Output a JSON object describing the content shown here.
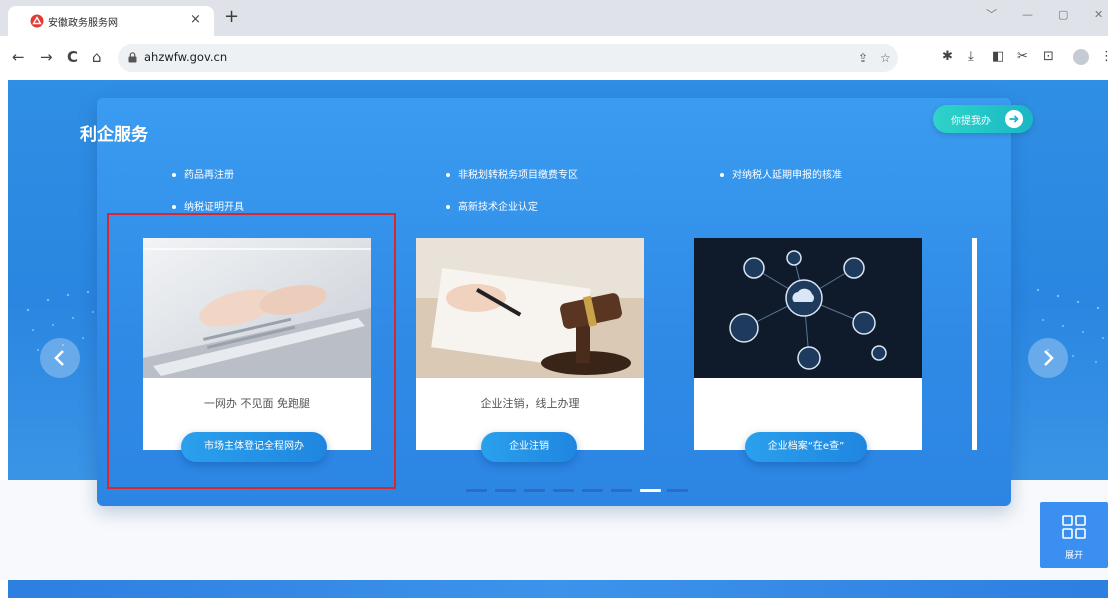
{
  "browser": {
    "tab_title": "安徽政务服务网",
    "tab_close": "×",
    "new_tab": "+",
    "url": "ahzwfw.gov.cn",
    "window_controls": [
      "﹀",
      "—",
      "▢",
      "✕"
    ],
    "nav": {
      "back": "←",
      "forward": "→",
      "reload": "C",
      "home": "⌂"
    },
    "toolbar_icons": [
      "share-icon",
      "star-icon",
      "extensions-icon",
      "download-icon",
      "sidebar-icon",
      "cut-icon",
      "devices-icon",
      "profile-icon",
      "menu-icon"
    ]
  },
  "page": {
    "section_title": "利企服务",
    "find_button": "你提我办",
    "service_links": [
      "药品再注册",
      "非税划转税务项目缴费专区",
      "对纳税人延期申报的核准",
      "纳税证明开具",
      "高新技术企业认定"
    ],
    "cards": [
      {
        "subtitle": "一网办 不见面 免跑腿",
        "button": "市场主体登记全程网办",
        "image": "laptop-typing-image"
      },
      {
        "subtitle": "企业注销，线上办理",
        "button": "企业注销",
        "image": "gavel-signing-image"
      },
      {
        "subtitle": "",
        "button": "企业档案“在e查”",
        "image": "network-cloud-image"
      }
    ],
    "pager": {
      "count": 8,
      "active_index": 6
    },
    "side_panel_label": "展开"
  },
  "colors": {
    "hero_blue": "#2f8fe4",
    "accent_teal": "#2fd3c8",
    "highlight_red": "#d8282e"
  }
}
